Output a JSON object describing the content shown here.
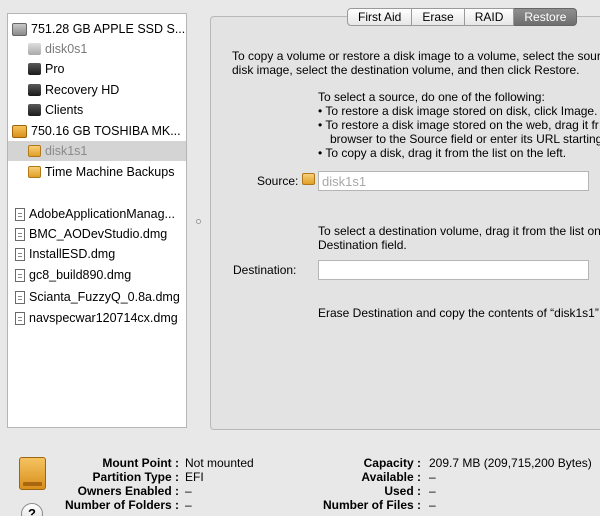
{
  "sidebar": {
    "items": [
      {
        "label": "751.28 GB APPLE SSD S...",
        "icon": "ssd-drive-icon"
      },
      {
        "label": "disk0s1",
        "icon": "volume-icon"
      },
      {
        "label": "Pro",
        "icon": "volume-icon"
      },
      {
        "label": "Recovery HD",
        "icon": "volume-icon"
      },
      {
        "label": "Clients",
        "icon": "volume-icon"
      },
      {
        "label": "750.16 GB TOSHIBA MK...",
        "icon": "external-drive-icon"
      },
      {
        "label": "disk1s1",
        "icon": "external-volume-icon"
      },
      {
        "label": "Time Machine Backups",
        "icon": "external-volume-icon"
      },
      {
        "label": "AdobeApplicationManag...",
        "icon": "disk-image-icon"
      },
      {
        "label": "BMC_AODevStudio.dmg",
        "icon": "disk-image-icon"
      },
      {
        "label": "InstallESD.dmg",
        "icon": "disk-image-icon"
      },
      {
        "label": "gc8_build890.dmg",
        "icon": "disk-image-icon"
      },
      {
        "label": "Scianta_FuzzyQ_0.8a.dmg",
        "icon": "disk-image-icon"
      },
      {
        "label": "navspecwar120714cx.dmg",
        "icon": "disk-image-icon"
      }
    ]
  },
  "tabs": [
    "First Aid",
    "Erase",
    "RAID",
    "Restore"
  ],
  "active_tab": "Restore",
  "restore": {
    "intro_line1": "To copy a volume or restore a disk image to a volume, select the source",
    "intro_line2": "disk image, select the destination volume, and then click Restore.",
    "source_heading": "To select a source, do one of the following:",
    "bullet1": "• To restore a disk image stored on disk, click Image.",
    "bullet2a": "• To restore a disk image stored on the web, drag it fr",
    "bullet2b": "browser to the Source field or enter its URL starting",
    "bullet3": "• To copy a disk, drag it from the list on the left.",
    "source_label": "Source:",
    "source_value": "disk1s1",
    "dest_help_line1": "To select a destination volume, drag it from the list on",
    "dest_help_line2": "Destination field.",
    "destination_label": "Destination:",
    "destination_value": "",
    "erase_note": "Erase Destination and copy the contents of “disk1s1” ("
  },
  "info": {
    "left": [
      {
        "key": "Mount Point :",
        "value": "Not mounted"
      },
      {
        "key": "Partition Type :",
        "value": "EFI"
      },
      {
        "key": "Owners Enabled :",
        "value": "–"
      },
      {
        "key": "Number of Folders :",
        "value": "–"
      }
    ],
    "right": [
      {
        "key": "Capacity :",
        "value": "209.7 MB (209,715,200 Bytes)"
      },
      {
        "key": "Available :",
        "value": "–"
      },
      {
        "key": "Used :",
        "value": "–"
      },
      {
        "key": "Number of Files :",
        "value": "–"
      }
    ],
    "help_label": "?"
  }
}
